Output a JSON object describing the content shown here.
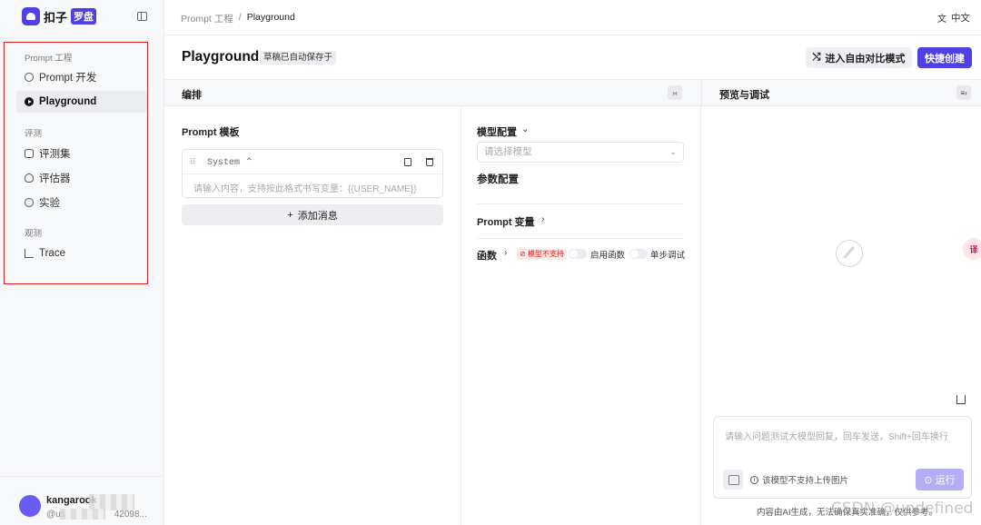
{
  "brand": {
    "name": "扣子",
    "badge": "罗盘"
  },
  "sidebar": {
    "groups": [
      {
        "title": "Prompt 工程",
        "items": [
          {
            "label": "Prompt 开发"
          },
          {
            "label": "Playground",
            "active": true
          }
        ]
      },
      {
        "title": "评测",
        "items": [
          {
            "label": "评测集"
          },
          {
            "label": "评估器"
          },
          {
            "label": "实验"
          }
        ]
      },
      {
        "title": "观测",
        "items": [
          {
            "label": "Trace"
          }
        ]
      }
    ],
    "user": {
      "name": "kangarook",
      "id_prefix": "@us",
      "id_suffix": "42098..."
    }
  },
  "breadcrumb": {
    "parent": "Prompt 工程",
    "separator": "/",
    "current": "Playground"
  },
  "language": {
    "label": "中文"
  },
  "header": {
    "title": "Playground",
    "draft_badge": "草稿已自动保存于",
    "compare_button": "进入自由对比模式",
    "create_button": "快捷创建"
  },
  "editor": {
    "section_title": "编排",
    "prompt_template_title": "Prompt 模板",
    "message": {
      "role": "System",
      "placeholder": "请输入内容，支持按此格式书写变量：{{USER_NAME}}"
    },
    "add_message": "添加消息",
    "model_config_title": "模型配置",
    "model_select_placeholder": "请选择模型",
    "param_config_title": "参数配置",
    "prompt_vars_title": "Prompt 变量",
    "functions_title": "函数",
    "unsupported_badge": "模型不支持",
    "enable_functions": "启用函数",
    "step_debug": "单步调试"
  },
  "preview": {
    "section_title": "预览与调试",
    "chat_placeholder": "请输入问题测试大模型回复，回车发送，Shift+回车换行",
    "image_note": "该模型不支持上传图片",
    "run_button": "运行",
    "footer_note": "内容由AI生成，无法确保真实准确，仅供参考。",
    "watermark": "CSDN @undefined"
  },
  "colors": {
    "accent": "#4e40e5",
    "highlight_border": "#e02020"
  }
}
